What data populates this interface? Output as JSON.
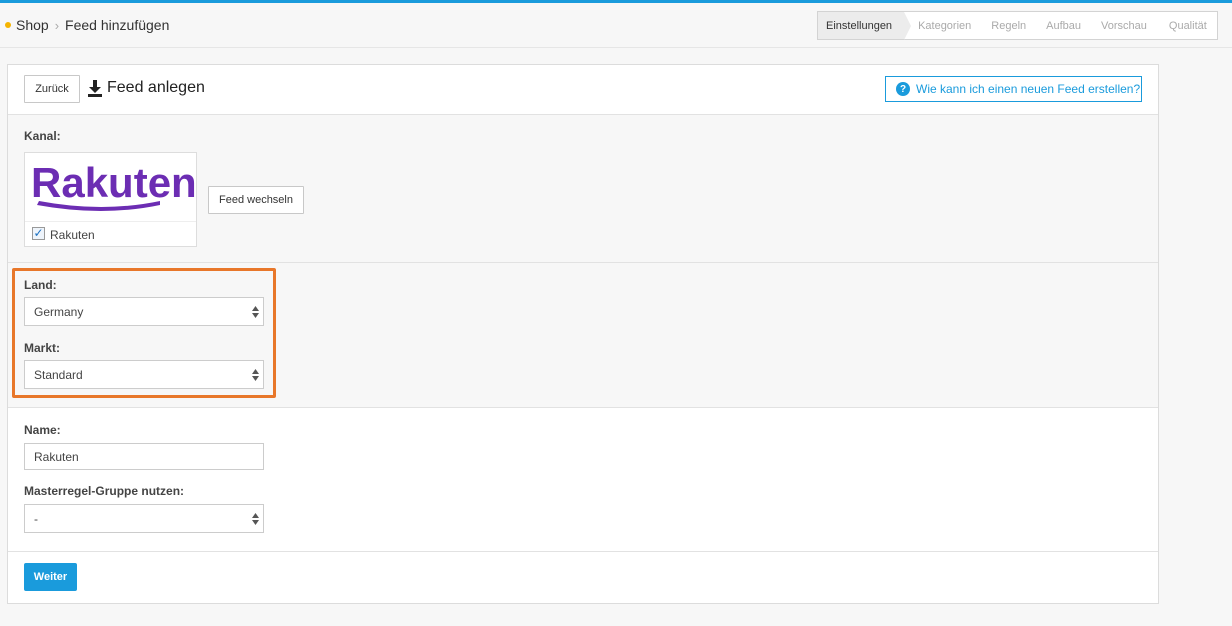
{
  "breadcrumb": {
    "root": "Shop",
    "current": "Feed hinzufügen"
  },
  "steps": [
    "Einstellungen",
    "Kategorien",
    "Regeln",
    "Aufbau",
    "Vorschau",
    "Qualität"
  ],
  "active_step": "Einstellungen",
  "header": {
    "back_label": "Zurück",
    "title": "Feed anlegen",
    "help_label": "Wie kann ich einen neuen Feed erstellen?"
  },
  "channel": {
    "label": "Kanal:",
    "logo_text": "Rakuten",
    "checkbox_label": "Rakuten",
    "checked": true,
    "switch_label": "Feed wechseln"
  },
  "land": {
    "label": "Land:",
    "value": "Germany"
  },
  "markt": {
    "label": "Markt:",
    "value": "Standard"
  },
  "name": {
    "label": "Name:",
    "value": "Rakuten"
  },
  "master": {
    "label": "Masterregel-Gruppe nutzen:",
    "value": "-"
  },
  "footer": {
    "next_label": "Weiter"
  },
  "colors": {
    "accent": "#1a9bdc",
    "highlight": "#e8772a",
    "brand": "#6c2db3"
  }
}
